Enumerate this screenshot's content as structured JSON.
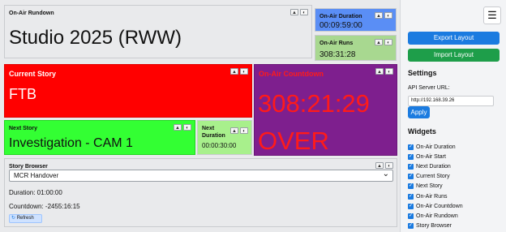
{
  "rundown": {
    "title": "On-Air Rundown",
    "value": "Studio 2025 (RWW)"
  },
  "duration": {
    "title": "On-Air Duration",
    "value": "00:09:59:00"
  },
  "runs": {
    "title": "On-Air Runs",
    "value": "308:31:28"
  },
  "current_story": {
    "title": "Current Story",
    "value": "FTB"
  },
  "countdown": {
    "title": "On-Air Countdown",
    "value": "308:21:29",
    "status": "OVER"
  },
  "next_story": {
    "title": "Next Story",
    "value": "Investigation - CAM 1"
  },
  "next_duration": {
    "title_line1": "Next",
    "title_line2": "Duration",
    "value": "00:00:30:00"
  },
  "story_browser": {
    "title": "Story Browser",
    "selected": "MCR Handover",
    "duration_text": "Duration: 01:00:00",
    "countdown_text": "Countdown: -2455:16:15",
    "refresh_label": "Refresh"
  },
  "controls": {
    "up_glyph": "▲",
    "toggle_glyph": "◐",
    "menu_glyph": "☰",
    "refresh_glyph": "↻",
    "check_glyph": "✓",
    "dropdown_glyph": "⌄"
  },
  "sidebar": {
    "export_label": "Export Layout",
    "import_label": "Import Layout",
    "settings_heading": "Settings",
    "api_label": "API Server URL:",
    "api_value": "http://192.168.39.26",
    "apply_label": "Apply",
    "widgets_heading": "Widgets",
    "widgets": [
      {
        "label": "On-Air Duration",
        "checked": true
      },
      {
        "label": "On-Air Start",
        "checked": true
      },
      {
        "label": "Next Duration",
        "checked": true
      },
      {
        "label": "Current Story",
        "checked": true
      },
      {
        "label": "Next Story",
        "checked": true
      },
      {
        "label": "On-Air Runs",
        "checked": true
      },
      {
        "label": "On-Air Countdown",
        "checked": true
      },
      {
        "label": "On-Air Rundown",
        "checked": true
      },
      {
        "label": "Story Browser",
        "checked": true
      }
    ]
  },
  "colors": {
    "duration_bg": "#5a8ef5",
    "runs_bg": "#a8d890",
    "current_story_bg": "#ff0000",
    "countdown_bg": "#7e1f8e",
    "countdown_text": "#ff1a1a",
    "next_story_bg": "#33ff33",
    "next_duration_bg": "#a8f08c",
    "export_bg": "#1b7be0",
    "import_bg": "#1e9e4a"
  }
}
